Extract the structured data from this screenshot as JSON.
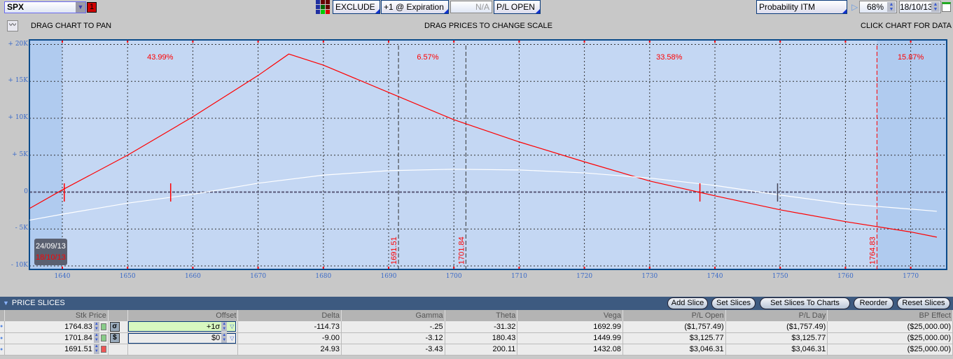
{
  "toolbar": {
    "symbol": "SPX",
    "flag": "1",
    "exclude": "EXCLUDE",
    "expiration": "+1 @ Expiration",
    "na": "N/A",
    "pl_open": "P/L OPEN",
    "probability": "Probability ITM",
    "prob_pct": "68%",
    "date": "18/10/13"
  },
  "hints": {
    "pan": "DRAG CHART TO PAN",
    "scale": "DRAG PRICES TO CHANGE SCALE",
    "click": "CLICK CHART FOR DATA"
  },
  "chart_data": {
    "type": "line",
    "xlim": [
      1635,
      1775.5
    ],
    "ylim": [
      -10,
      20
    ],
    "x_ticks": [
      "1640",
      "1650",
      "1660",
      "1670",
      "1680",
      "1690",
      "1700",
      "1710",
      "1720",
      "1730",
      "1740",
      "1750",
      "1760",
      "1770"
    ],
    "y_ticks": [
      "+ 20K",
      "+ 15K",
      "+ 10K",
      "+ 5K",
      "0",
      "- 5K",
      "- 10K"
    ],
    "series": [
      {
        "name": "Expiration",
        "color": "#ff0000",
        "x": [
          1635,
          1640,
          1650,
          1660,
          1670,
          1674.7,
          1680,
          1690,
          1700,
          1710,
          1720,
          1730,
          1740,
          1750,
          1760,
          1770,
          1774
        ],
        "y": [
          -2.2,
          0.3,
          5,
          10.2,
          15.8,
          18.7,
          17.2,
          13.5,
          9.8,
          6.8,
          4.1,
          1.5,
          -0.5,
          -2.4,
          -4,
          -5.4,
          -6.1
        ]
      },
      {
        "name": "Today",
        "color": "#ffffff",
        "x": [
          1635,
          1640,
          1650,
          1660,
          1670,
          1680,
          1690,
          1700,
          1710,
          1720,
          1730,
          1740,
          1750,
          1760,
          1770,
          1774
        ],
        "y": [
          -3.8,
          -3,
          -1.5,
          -0.3,
          1.2,
          2.3,
          2.9,
          3.1,
          3,
          2.6,
          1.9,
          0.9,
          -0.4,
          -1.6,
          -2.3,
          -2.6
        ]
      }
    ],
    "breakevens_exp": [
      1640.3,
      1737.7
    ],
    "breakevens_today": [
      1656.6,
      1749.6
    ],
    "slices": [
      {
        "price": 1691.51,
        "label": "1691.51",
        "color": "#333"
      },
      {
        "price": 1701.84,
        "label": "1701.84",
        "color": "#333"
      },
      {
        "price": 1764.83,
        "label": "1764.83",
        "color": "#ff0000"
      }
    ],
    "probabilities": [
      {
        "text": "43.99%",
        "at": 1655
      },
      {
        "text": "6.57%",
        "at": 1696
      },
      {
        "text": "33.58%",
        "at": 1733
      },
      {
        "text": "15.87%",
        "at": 1770
      }
    ],
    "date_box": {
      "today": "24/09/13",
      "exp": "18/10/13"
    }
  },
  "slices_panel": {
    "title": "PRICE SLICES",
    "buttons": [
      "Add Slice",
      "Set Slices",
      "Set Slices To Charts",
      "Reorder",
      "Reset Slices"
    ],
    "columns": [
      "Stk Price",
      "Offset",
      "Delta",
      "Gamma",
      "Theta",
      "Vega",
      "P/L Open",
      "P/L Day",
      "BP Effect"
    ],
    "rows": [
      {
        "price": "1764.83",
        "type": "σ",
        "offset": "+1σ",
        "delta": "-114.73",
        "gamma": "-.25",
        "theta": "-31.32",
        "vega": "1692.99",
        "pl_open": "($1,757.49)",
        "pl_day": "($1,757.49)",
        "bp": "($25,000.00)"
      },
      {
        "price": "1701.84",
        "type": "$",
        "offset": "$0",
        "delta": "-9.00",
        "gamma": "-3.12",
        "theta": "180.43",
        "vega": "1449.99",
        "pl_open": "$3,125.77",
        "pl_day": "$3,125.77",
        "bp": "($25,000.00)"
      },
      {
        "price": "1691.51",
        "type": "",
        "offset": "",
        "delta": "24.93",
        "gamma": "-3.43",
        "theta": "200.11",
        "vega": "1432.08",
        "pl_open": "$3,046.31",
        "pl_day": "$3,046.31",
        "bp": "($25,000.00)"
      }
    ]
  }
}
